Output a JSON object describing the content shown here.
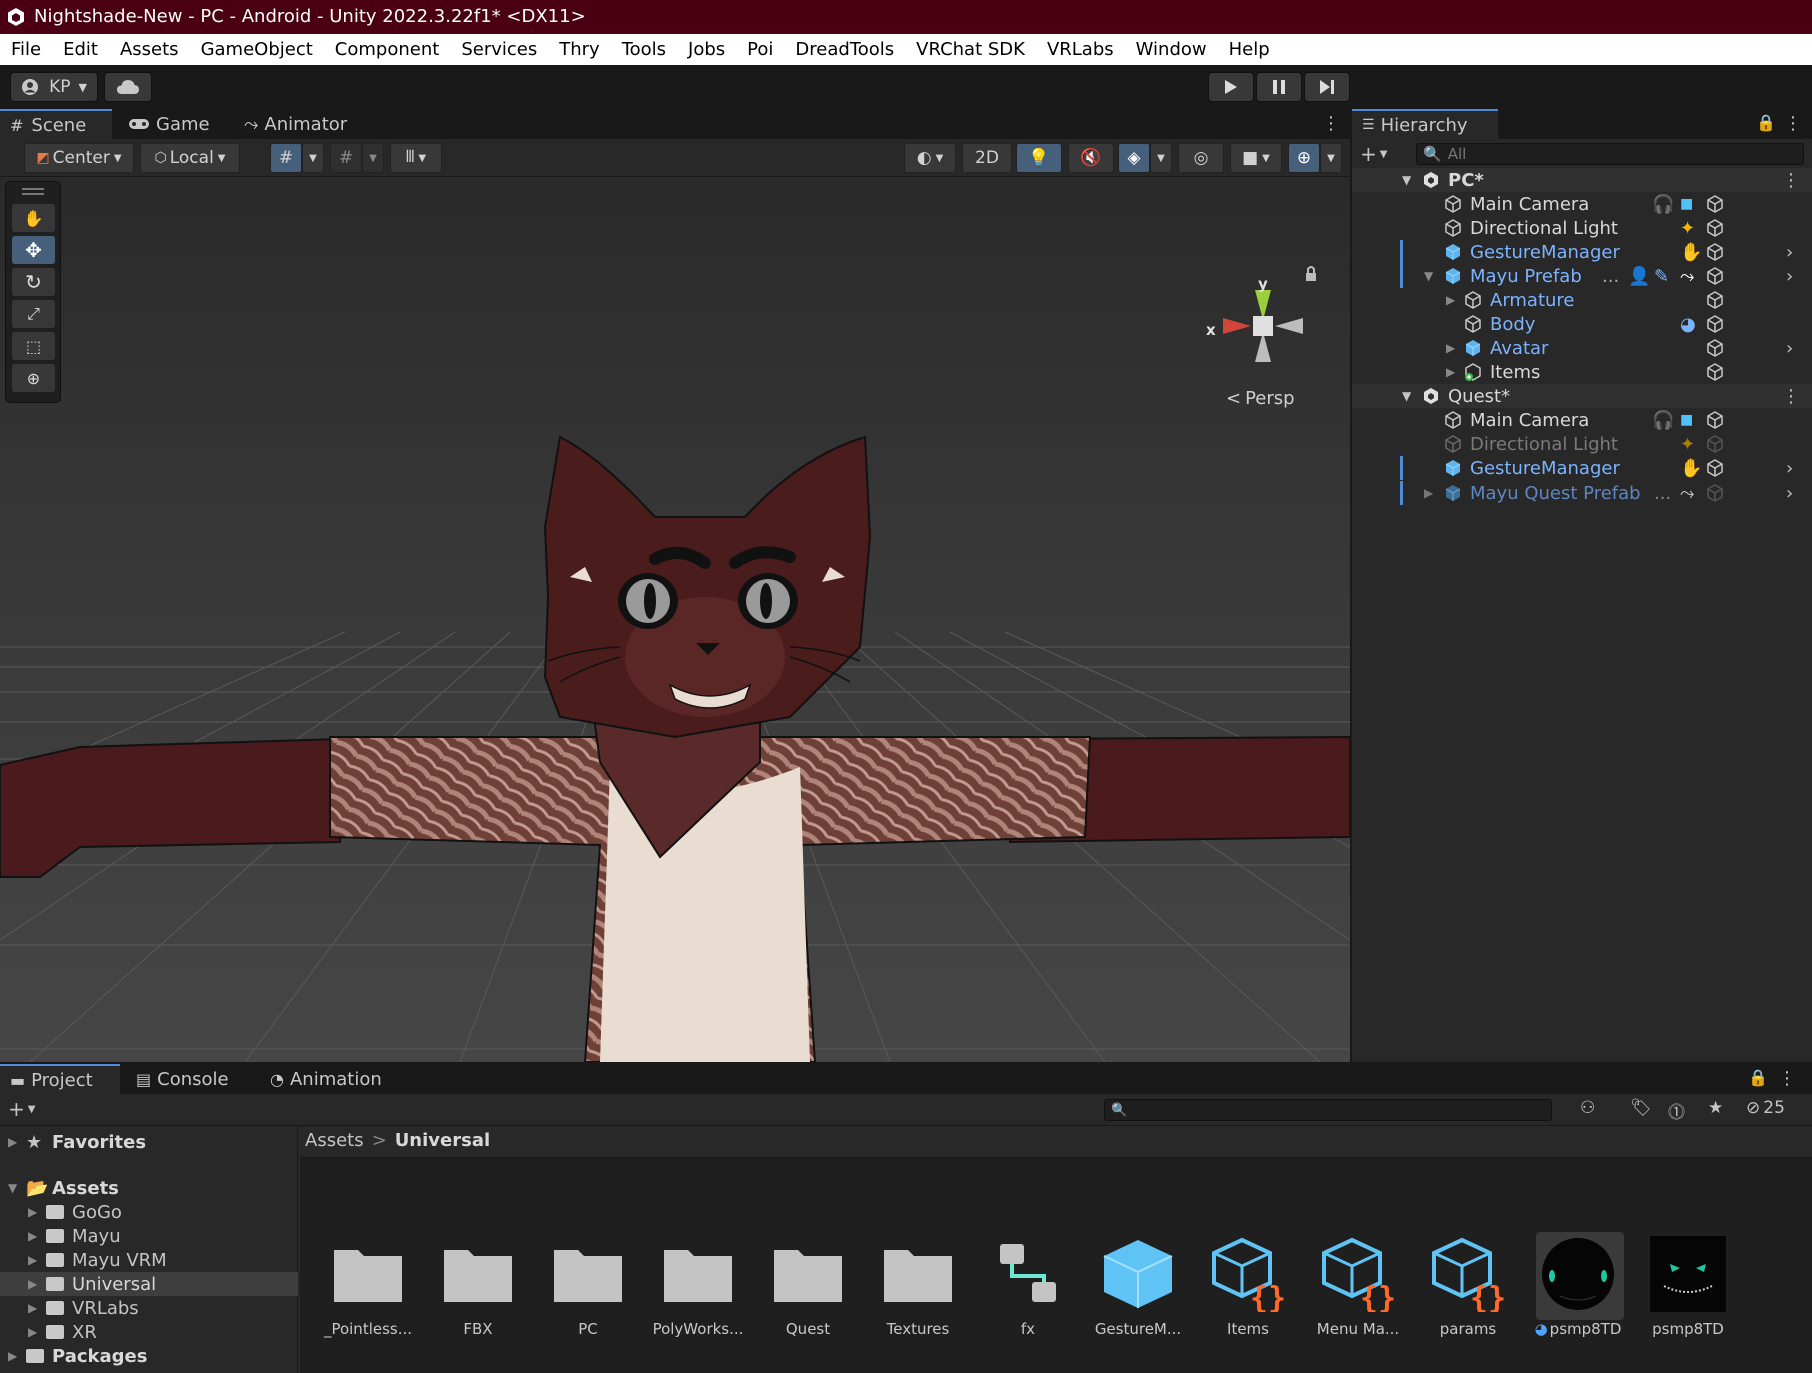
{
  "window": {
    "title": "Nightshade-New - PC - Android - Unity 2022.3.22f1* <DX11>"
  },
  "menu": [
    "File",
    "Edit",
    "Assets",
    "GameObject",
    "Component",
    "Services",
    "Thry",
    "Tools",
    "Jobs",
    "Poi",
    "DreadTools",
    "VRChat SDK",
    "VRLabs",
    "Window",
    "Help"
  ],
  "toolbar": {
    "account": "KP"
  },
  "scene_tabs": [
    "Scene",
    "Game",
    "Animator"
  ],
  "scene_toolbar": {
    "pivot": "Center",
    "space": "Local",
    "mode_2d": "2D"
  },
  "gizmo": {
    "x": "x",
    "y": "y",
    "projection": "Persp"
  },
  "hierarchy": {
    "title": "Hierarchy",
    "search_placeholder": "All",
    "rows": [
      {
        "label": "PC*"
      },
      {
        "label": "Main Camera"
      },
      {
        "label": "Directional Light"
      },
      {
        "label": "GestureManager"
      },
      {
        "label": "Mayu Prefab",
        "suffix": "..."
      },
      {
        "label": "Armature"
      },
      {
        "label": "Body"
      },
      {
        "label": "Avatar"
      },
      {
        "label": "Items"
      },
      {
        "label": "Quest*"
      },
      {
        "label": "Main Camera"
      },
      {
        "label": "Directional Light"
      },
      {
        "label": "GestureManager"
      },
      {
        "label": "Mayu Quest Prefab",
        "suffix": "..."
      }
    ]
  },
  "bottom_tabs": [
    "Project",
    "Console",
    "Animation"
  ],
  "project": {
    "hidden_count": "25",
    "tree": [
      {
        "label": "Favorites"
      },
      {
        "label": "Assets"
      },
      {
        "label": "GoGo"
      },
      {
        "label": "Mayu"
      },
      {
        "label": "Mayu VRM"
      },
      {
        "label": "Universal"
      },
      {
        "label": "VRLabs"
      },
      {
        "label": "XR"
      },
      {
        "label": "Packages"
      }
    ],
    "breadcrumb": {
      "root": "Assets",
      "current": "Universal",
      "sep": ">"
    },
    "assets": [
      {
        "name": "_Pointless...",
        "icon": "folder-icon"
      },
      {
        "name": "FBX",
        "icon": "folder-icon"
      },
      {
        "name": "PC",
        "icon": "folder-icon"
      },
      {
        "name": "PolyWorks...",
        "icon": "folder-icon"
      },
      {
        "name": "Quest",
        "icon": "folder-icon"
      },
      {
        "name": "Textures",
        "icon": "folder-icon"
      },
      {
        "name": "fx",
        "icon": "animator-controller-icon"
      },
      {
        "name": "GestureM...",
        "icon": "prefab-icon"
      },
      {
        "name": "Items",
        "icon": "expression-menu-icon"
      },
      {
        "name": "Menu Ma...",
        "icon": "expression-menu-icon"
      },
      {
        "name": "params",
        "icon": "expression-params-icon"
      },
      {
        "name": "psmp8TD",
        "icon": "material-sphere-icon"
      },
      {
        "name": "psmp8TD",
        "icon": "texture-icon"
      }
    ]
  },
  "colors": {
    "title_bar": "#4a0012",
    "accent": "#4f8ad6",
    "prefab_blue": "#7bb3ff"
  }
}
